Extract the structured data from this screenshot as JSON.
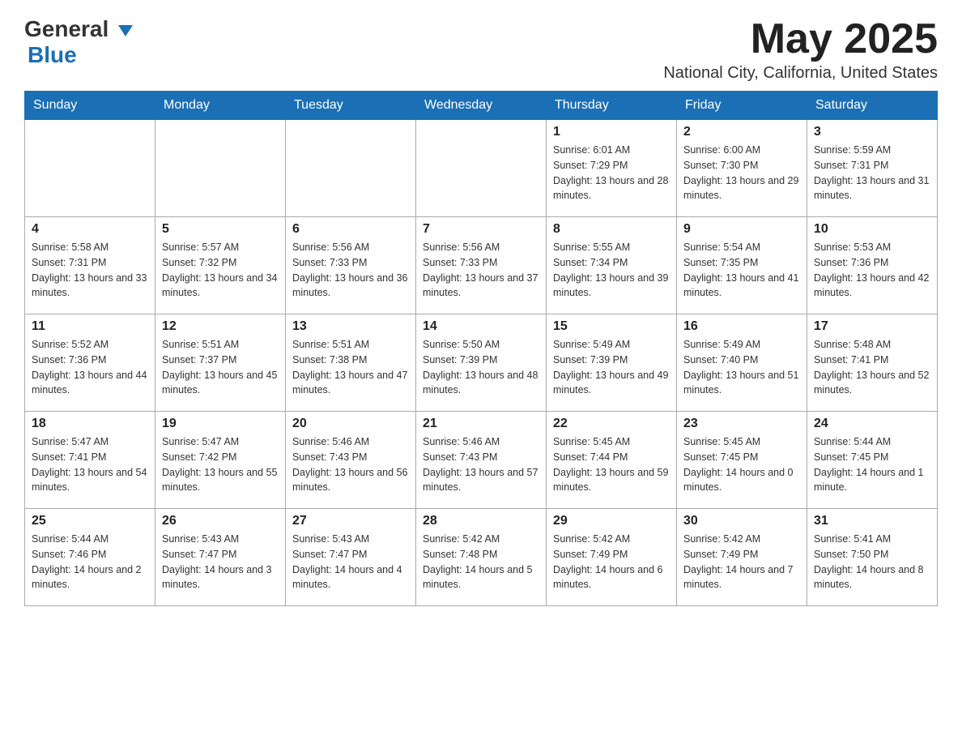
{
  "header": {
    "logo_main": "General",
    "logo_accent": "Blue",
    "month_title": "May 2025",
    "location": "National City, California, United States"
  },
  "days_of_week": [
    "Sunday",
    "Monday",
    "Tuesday",
    "Wednesday",
    "Thursday",
    "Friday",
    "Saturday"
  ],
  "weeks": [
    [
      {
        "day": "",
        "info": ""
      },
      {
        "day": "",
        "info": ""
      },
      {
        "day": "",
        "info": ""
      },
      {
        "day": "",
        "info": ""
      },
      {
        "day": "1",
        "info": "Sunrise: 6:01 AM\nSunset: 7:29 PM\nDaylight: 13 hours and 28 minutes."
      },
      {
        "day": "2",
        "info": "Sunrise: 6:00 AM\nSunset: 7:30 PM\nDaylight: 13 hours and 29 minutes."
      },
      {
        "day": "3",
        "info": "Sunrise: 5:59 AM\nSunset: 7:31 PM\nDaylight: 13 hours and 31 minutes."
      }
    ],
    [
      {
        "day": "4",
        "info": "Sunrise: 5:58 AM\nSunset: 7:31 PM\nDaylight: 13 hours and 33 minutes."
      },
      {
        "day": "5",
        "info": "Sunrise: 5:57 AM\nSunset: 7:32 PM\nDaylight: 13 hours and 34 minutes."
      },
      {
        "day": "6",
        "info": "Sunrise: 5:56 AM\nSunset: 7:33 PM\nDaylight: 13 hours and 36 minutes."
      },
      {
        "day": "7",
        "info": "Sunrise: 5:56 AM\nSunset: 7:33 PM\nDaylight: 13 hours and 37 minutes."
      },
      {
        "day": "8",
        "info": "Sunrise: 5:55 AM\nSunset: 7:34 PM\nDaylight: 13 hours and 39 minutes."
      },
      {
        "day": "9",
        "info": "Sunrise: 5:54 AM\nSunset: 7:35 PM\nDaylight: 13 hours and 41 minutes."
      },
      {
        "day": "10",
        "info": "Sunrise: 5:53 AM\nSunset: 7:36 PM\nDaylight: 13 hours and 42 minutes."
      }
    ],
    [
      {
        "day": "11",
        "info": "Sunrise: 5:52 AM\nSunset: 7:36 PM\nDaylight: 13 hours and 44 minutes."
      },
      {
        "day": "12",
        "info": "Sunrise: 5:51 AM\nSunset: 7:37 PM\nDaylight: 13 hours and 45 minutes."
      },
      {
        "day": "13",
        "info": "Sunrise: 5:51 AM\nSunset: 7:38 PM\nDaylight: 13 hours and 47 minutes."
      },
      {
        "day": "14",
        "info": "Sunrise: 5:50 AM\nSunset: 7:39 PM\nDaylight: 13 hours and 48 minutes."
      },
      {
        "day": "15",
        "info": "Sunrise: 5:49 AM\nSunset: 7:39 PM\nDaylight: 13 hours and 49 minutes."
      },
      {
        "day": "16",
        "info": "Sunrise: 5:49 AM\nSunset: 7:40 PM\nDaylight: 13 hours and 51 minutes."
      },
      {
        "day": "17",
        "info": "Sunrise: 5:48 AM\nSunset: 7:41 PM\nDaylight: 13 hours and 52 minutes."
      }
    ],
    [
      {
        "day": "18",
        "info": "Sunrise: 5:47 AM\nSunset: 7:41 PM\nDaylight: 13 hours and 54 minutes."
      },
      {
        "day": "19",
        "info": "Sunrise: 5:47 AM\nSunset: 7:42 PM\nDaylight: 13 hours and 55 minutes."
      },
      {
        "day": "20",
        "info": "Sunrise: 5:46 AM\nSunset: 7:43 PM\nDaylight: 13 hours and 56 minutes."
      },
      {
        "day": "21",
        "info": "Sunrise: 5:46 AM\nSunset: 7:43 PM\nDaylight: 13 hours and 57 minutes."
      },
      {
        "day": "22",
        "info": "Sunrise: 5:45 AM\nSunset: 7:44 PM\nDaylight: 13 hours and 59 minutes."
      },
      {
        "day": "23",
        "info": "Sunrise: 5:45 AM\nSunset: 7:45 PM\nDaylight: 14 hours and 0 minutes."
      },
      {
        "day": "24",
        "info": "Sunrise: 5:44 AM\nSunset: 7:45 PM\nDaylight: 14 hours and 1 minute."
      }
    ],
    [
      {
        "day": "25",
        "info": "Sunrise: 5:44 AM\nSunset: 7:46 PM\nDaylight: 14 hours and 2 minutes."
      },
      {
        "day": "26",
        "info": "Sunrise: 5:43 AM\nSunset: 7:47 PM\nDaylight: 14 hours and 3 minutes."
      },
      {
        "day": "27",
        "info": "Sunrise: 5:43 AM\nSunset: 7:47 PM\nDaylight: 14 hours and 4 minutes."
      },
      {
        "day": "28",
        "info": "Sunrise: 5:42 AM\nSunset: 7:48 PM\nDaylight: 14 hours and 5 minutes."
      },
      {
        "day": "29",
        "info": "Sunrise: 5:42 AM\nSunset: 7:49 PM\nDaylight: 14 hours and 6 minutes."
      },
      {
        "day": "30",
        "info": "Sunrise: 5:42 AM\nSunset: 7:49 PM\nDaylight: 14 hours and 7 minutes."
      },
      {
        "day": "31",
        "info": "Sunrise: 5:41 AM\nSunset: 7:50 PM\nDaylight: 14 hours and 8 minutes."
      }
    ]
  ]
}
